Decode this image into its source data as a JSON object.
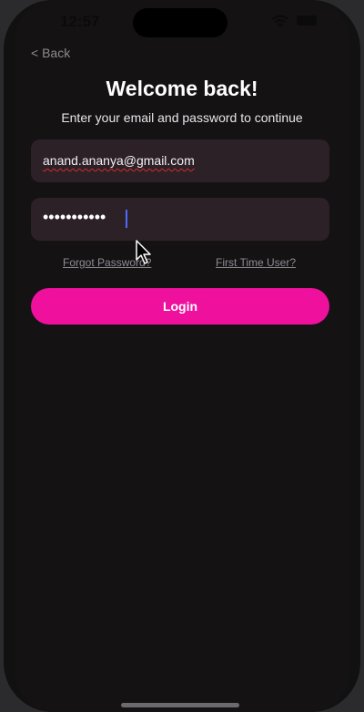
{
  "status_bar": {
    "time": "12:57",
    "icons": [
      "wifi-icon",
      "battery-icon"
    ]
  },
  "nav": {
    "back_label": "< Back"
  },
  "header": {
    "title": "Welcome back!",
    "subtitle": "Enter your email and password to continue"
  },
  "form": {
    "email_value": "anand.ananya@gmail.com",
    "password_value": "•••••••••••"
  },
  "links": {
    "forgot_password": "Forgot Password?",
    "first_time_user": "First Time User?"
  },
  "actions": {
    "login_label": "Login"
  },
  "colors": {
    "accent": "#ef109d",
    "background": "#151214",
    "field_background": "#2d2128"
  }
}
